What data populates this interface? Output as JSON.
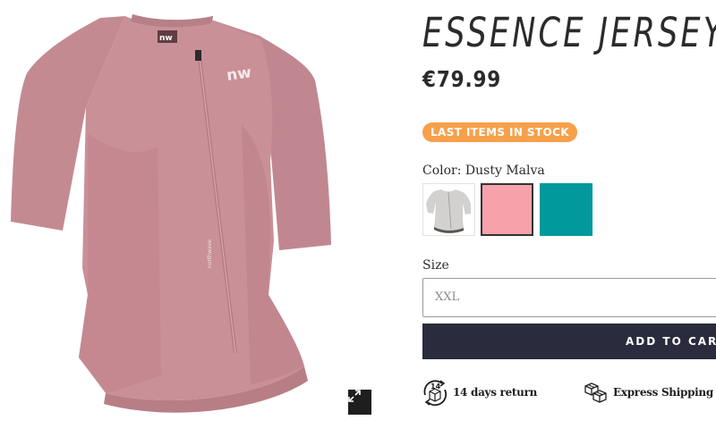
{
  "product": {
    "title": "ESSENCE JERSEY",
    "price": "€79.99",
    "stock_badge": "LAST ITEMS IN STOCK",
    "image_alt": "Dusty Malva short sleeve cycling jersey",
    "image_logo": "nw"
  },
  "color": {
    "label": "Color: Dusty Malva",
    "swatches": [
      {
        "name": "Light grey",
        "hex": "#d3d1cf",
        "type": "photo"
      },
      {
        "name": "Dusty Malva",
        "hex": "#f7a2aa",
        "selected": true
      },
      {
        "name": "Teal",
        "hex": "#01999b"
      }
    ]
  },
  "size": {
    "label": "Size",
    "selected": "XXL"
  },
  "cart": {
    "add_label": "ADD TO CART"
  },
  "features": {
    "return_badge": "14",
    "return_label": "14 days return",
    "shipping_label": "Express Shipping"
  },
  "colors": {
    "badge": "#f7a04b",
    "cart_button": "#2a2b3d",
    "jersey": "#c68c94"
  },
  "icons": [
    "expand-icon",
    "return-box-icon",
    "shipping-boxes-icon"
  ]
}
